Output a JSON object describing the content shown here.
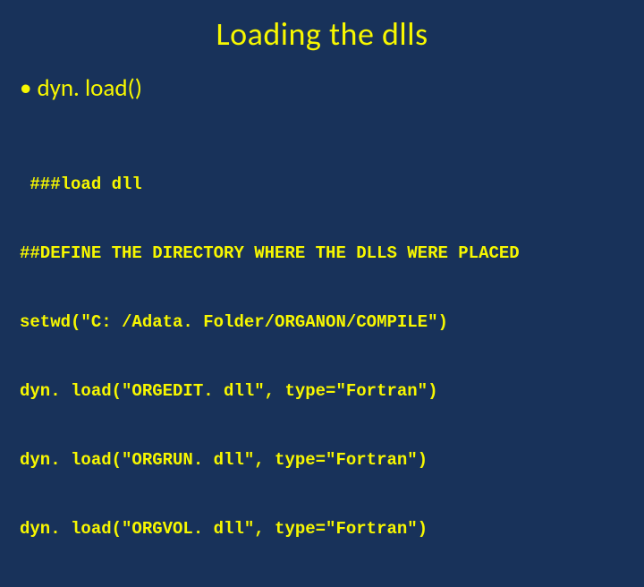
{
  "slide": {
    "title": "Loading the dlls",
    "bullet": {
      "marker": "•",
      "text": "dyn. load()"
    },
    "code": {
      "line1": " ###load dll",
      "line2": "##DEFINE THE DIRECTORY WHERE THE DLLS WERE PLACED",
      "line3": "setwd(\"C: /Adata. Folder/ORGANON/COMPILE\")",
      "line4": "dyn. load(\"ORGEDIT. dll\", type=\"Fortran\")",
      "line5": "dyn. load(\"ORGRUN. dll\", type=\"Fortran\")",
      "line6": "dyn. load(\"ORGVOL. dll\", type=\"Fortran\")"
    }
  }
}
